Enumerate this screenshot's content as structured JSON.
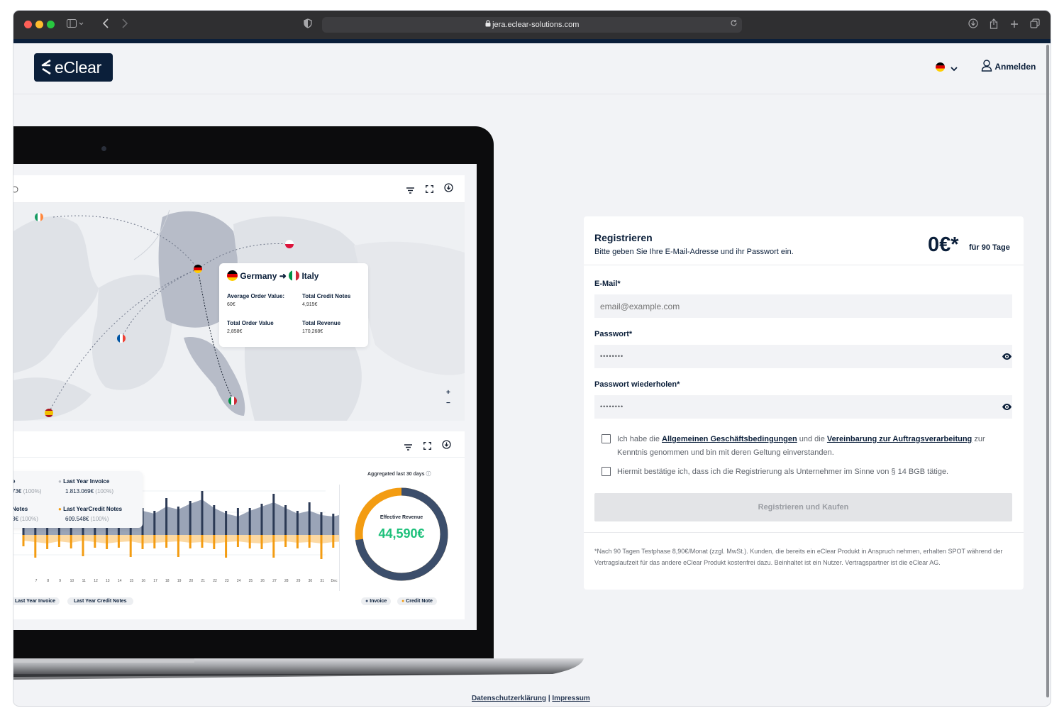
{
  "browser": {
    "url": "jera.eclear-solutions.com"
  },
  "header": {
    "logo_text": "eClear",
    "login_label": "Anmelden"
  },
  "dashboard": {
    "route": {
      "from": "Germany",
      "to": "Italy"
    },
    "stats": [
      {
        "label": "Average Order Value:",
        "value": "60€"
      },
      {
        "label": "Total Credit Notes",
        "value": "4,915€"
      },
      {
        "label": "Total Order Value",
        "value": "2,858€"
      },
      {
        "label": "Total Revenue",
        "value": "170,268€"
      }
    ],
    "legend_tooltip": [
      {
        "label": "Last Year Invoice",
        "value": "1.813.069€",
        "pct": "(100%)",
        "left_label": "e",
        "left_value": "73€",
        "left_pct": "(100%)"
      },
      {
        "label": "Last YearCredit Notes",
        "value": "609.548€",
        "pct": "(100%)",
        "left_label": "Notes",
        "left_value": "3€",
        "left_pct": "(100%)"
      }
    ],
    "aggregated_label": "Aggregated last 30 days",
    "donut_label": "Effective Revenue",
    "donut_value": "44,590€",
    "donut_invoice_fraction": 0.73,
    "x_ticks": [
      "7",
      "8",
      "9",
      "10",
      "11",
      "12",
      "13",
      "14",
      "15",
      "16",
      "17",
      "18",
      "19",
      "20",
      "21",
      "22",
      "23",
      "24",
      "25",
      "26",
      "27",
      "28",
      "29",
      "30",
      "31",
      "Dec"
    ],
    "bottom_legend": [
      "Last Year Invoice",
      "Last Year Credit Notes"
    ],
    "donut_legend": [
      "Invoice",
      "Credit Note"
    ],
    "zoom_plus": "+",
    "zoom_minus": "−"
  },
  "form": {
    "title": "Registrieren",
    "subtitle": "Bitte geben Sie Ihre E-Mail-Adresse und ihr Passwort ein.",
    "price": "0€*",
    "price_sub": "für 90 Tage",
    "email_label": "E-Mail*",
    "email_placeholder": "email@example.com",
    "password_label": "Passwort*",
    "password_value": "••••••••",
    "password_repeat_label": "Passwort wiederholen*",
    "password_repeat_value": "••••••••",
    "terms": {
      "pre": "Ich habe die ",
      "link1": "Allgemeinen Geschäftsbedingungen",
      "mid": " und die ",
      "link2": "Vereinbarung zur Auftragsverarbeitung",
      "post": " zur Kenntnis genommen und bin mit deren Geltung einverstanden."
    },
    "business_confirm": "Hiermit bestätige ich, dass ich die Registrierung als Unternehmer im Sinne von § 14 BGB tätige.",
    "submit_label": "Registrieren und Kaufen",
    "footnote": "*Nach 90 Tagen Testphase 8,90€/Monat (zzgl. MwSt.). Kunden, die bereits ein eClear Produkt in Anspruch nehmen, erhalten SPOT während der Vertragslaufzeit für das andere eClear Produkt kostenfrei dazu. Beinhaltet ist ein Nutzer. Vertragspartner ist die eClear AG."
  },
  "footer": {
    "privacy": "Datenschutzerklärung",
    "separator": "|",
    "imprint": "Impressum"
  },
  "colors": {
    "navy": "#0b1f3a",
    "orange": "#f39c12",
    "green": "#1cc07a",
    "slate": "#3c4e6b"
  }
}
